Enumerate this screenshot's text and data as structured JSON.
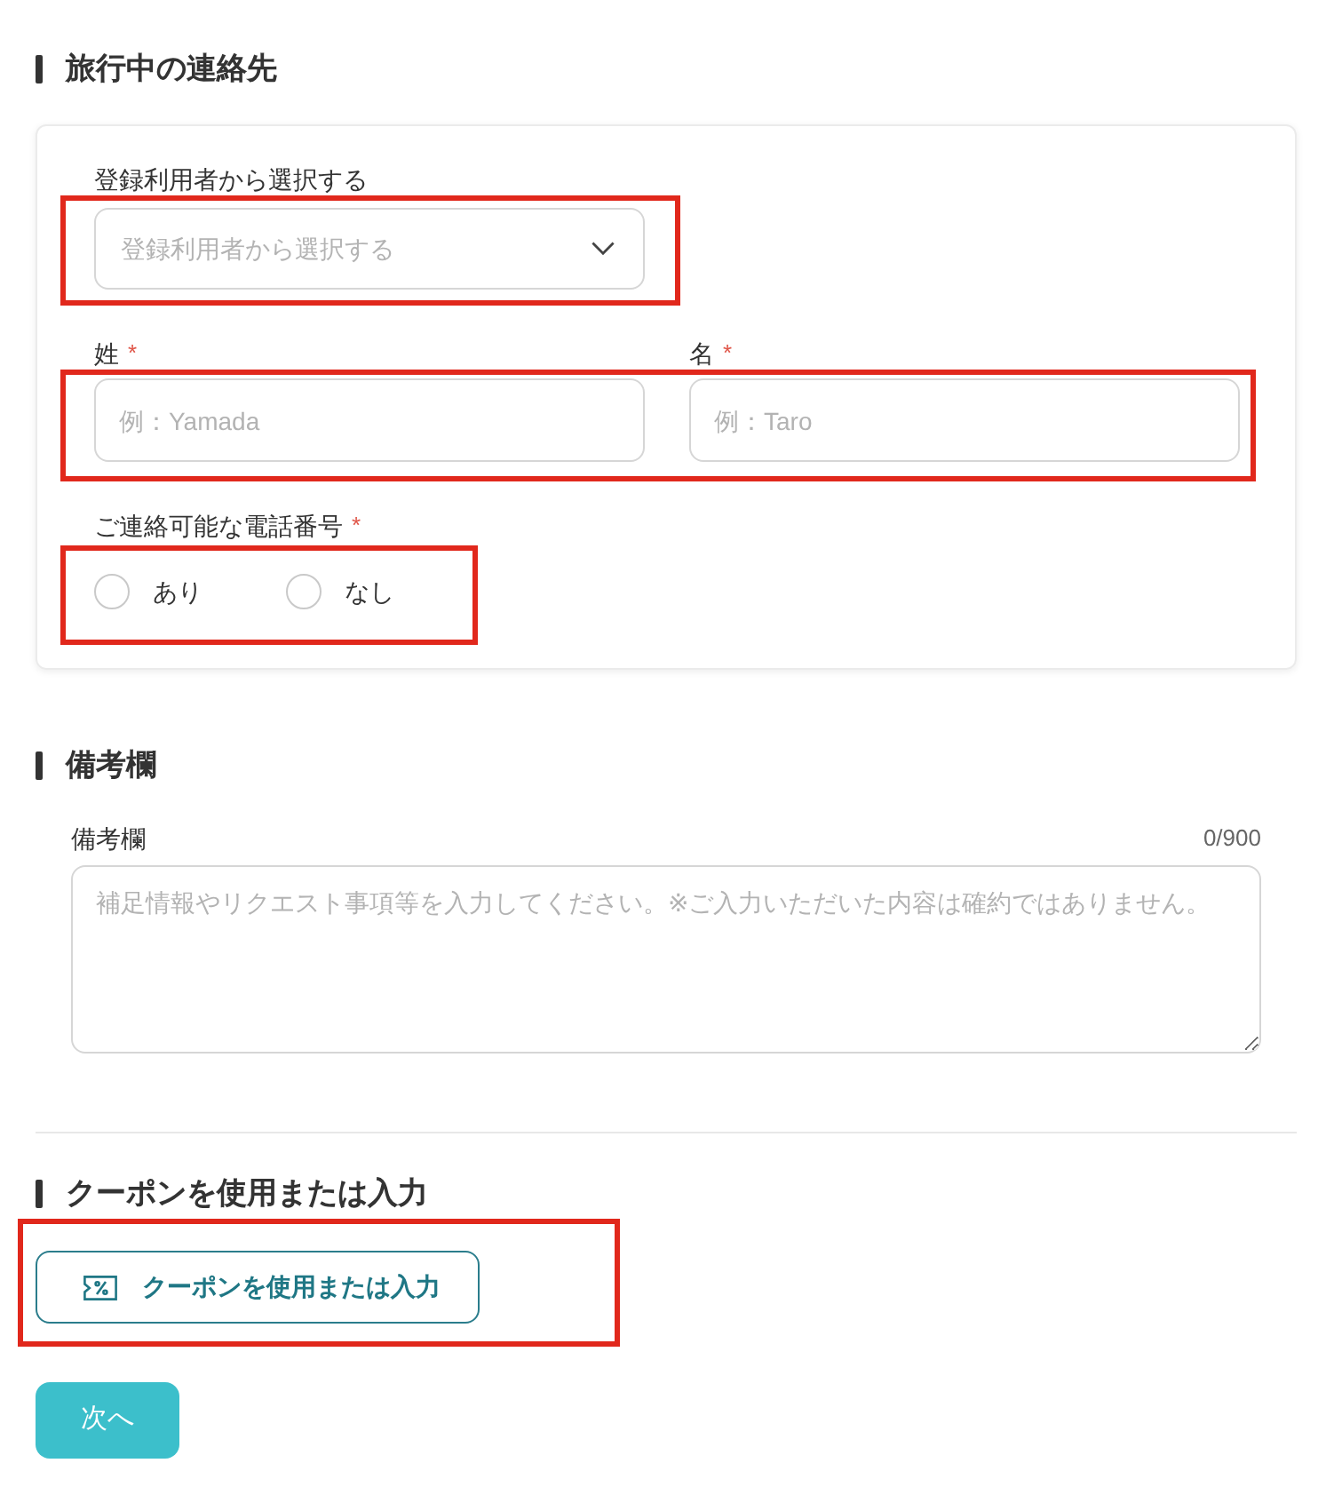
{
  "contact_section": {
    "heading": "旅行中の連絡先",
    "registered_user": {
      "label": "登録利用者から選択する",
      "placeholder": "登録利用者から選択する",
      "highlighted": true
    },
    "name_fields": {
      "highlighted": true,
      "fields": [
        {
          "label": "姓",
          "required_mark": "*",
          "placeholder": "例：Yamada"
        },
        {
          "label": "名",
          "required_mark": "*",
          "placeholder": "例：Taro"
        }
      ]
    },
    "phone": {
      "label": "ご連絡可能な電話番号",
      "required_mark": "*",
      "highlighted": true,
      "options": [
        {
          "label": "あり",
          "selected": false
        },
        {
          "label": "なし",
          "selected": false
        }
      ]
    }
  },
  "remarks_section": {
    "heading": "備考欄",
    "label": "備考欄",
    "counter": "0/900",
    "placeholder": "補足情報やリクエスト事項等を入力してください。※ご入力いただいた内容は確約ではありません。"
  },
  "coupon_section": {
    "heading": "クーポンを使用または入力",
    "button": {
      "label": "クーポンを使用または入力",
      "highlighted": true
    }
  },
  "next_button": {
    "label": "次へ"
  }
}
